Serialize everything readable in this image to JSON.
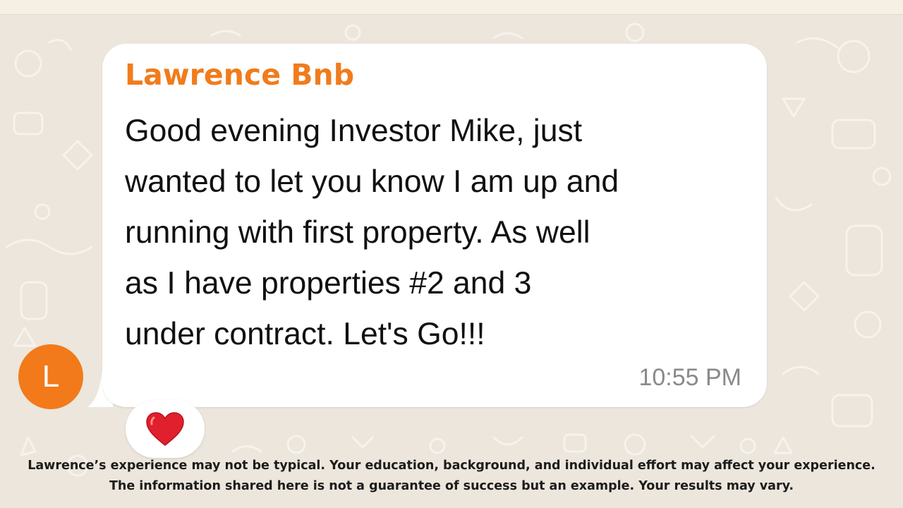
{
  "chat": {
    "sender_name": "Lawrence Bnb",
    "message_text": "Good evening Investor Mike, just\nwanted to let you know I am up and\nrunning with first property.  As  well\nas I have  properties #2  and  3\nunder contract.  Let's Go!!!",
    "timestamp": "10:55 PM",
    "avatar_initial": "L",
    "reaction_icon": "heart-icon"
  },
  "disclaimer": {
    "line1": "Lawrence’s experience may not be typical. Your education, background, and individual effort may affect your experience.",
    "line2": "The information shared here is not a guarantee of success but an example. Your results may vary."
  },
  "colors": {
    "sender_name": "#f07c1c",
    "avatar": "#f27a1a",
    "wallpaper": "#ece6dc",
    "bubble": "#ffffff",
    "heart": "#e0202c"
  }
}
